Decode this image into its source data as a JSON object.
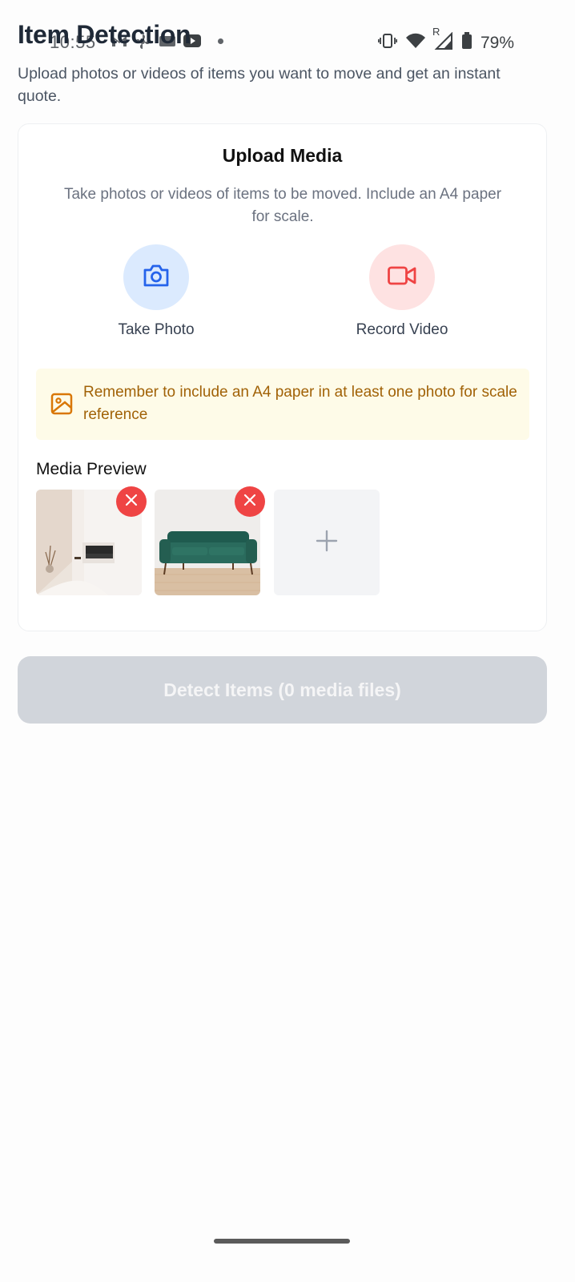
{
  "status_bar": {
    "time": "10:55",
    "battery": "79%",
    "signal_badge": "R",
    "icons": [
      "gmail-icon",
      "fan-icon",
      "window-icon",
      "youtube-icon",
      "notification-dot",
      "vibrate-icon",
      "wifi-icon",
      "signal-icon",
      "battery-icon"
    ]
  },
  "header": {
    "title": "Item Detection",
    "subtitle": "Upload photos or videos of items you want to move and get an instant quote."
  },
  "upload": {
    "title": "Upload Media",
    "description": "Take photos or videos of items to be moved. Include an A4 paper for scale.",
    "take_photo_label": "Take Photo",
    "record_video_label": "Record Video",
    "notice": "Remember to include an A4 paper in at least one photo for scale reference",
    "preview_title": "Media Preview",
    "thumbnails": [
      {
        "name": "room-interior-photo",
        "icon": "close-icon"
      },
      {
        "name": "green-sofa-photo",
        "icon": "close-icon"
      }
    ],
    "add_icon": "plus-icon"
  },
  "detect_button_label": "Detect Items (0 media files)",
  "colors": {
    "photo_circle_bg": "#dbeafe",
    "photo_icon": "#2563eb",
    "video_circle_bg": "#fee2e2",
    "video_icon": "#ef4444",
    "notice_bg": "#fefbe8",
    "notice_text": "#a16207",
    "remove_button": "#ef4444",
    "detect_button_bg": "#d1d5db"
  }
}
